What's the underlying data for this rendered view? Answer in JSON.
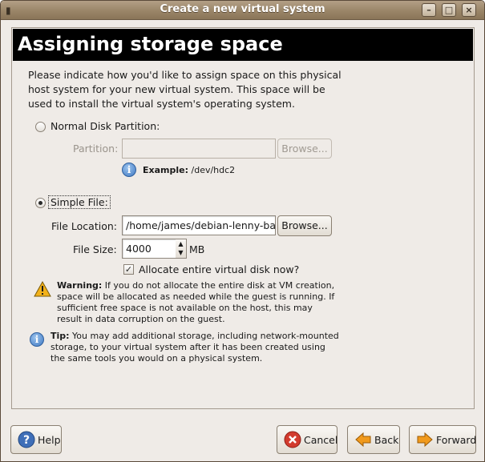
{
  "window": {
    "title": "Create a new virtual system"
  },
  "banner": {
    "title": "Assigning storage space"
  },
  "intro": {
    "text": "Please indicate how you'd like to assign space on this physical host system for your new virtual system. This space will be used to install the virtual system's operating system."
  },
  "normal_disk": {
    "radio_label": "Normal Disk Partition:",
    "partition_label": "Partition:",
    "partition_value": "",
    "browse_label": "Browse...",
    "example_label": "Example:",
    "example_value": "/dev/hdc2"
  },
  "simple_file": {
    "radio_label": "Simple File:",
    "location_label": "File Location:",
    "location_value": "/home/james/debian-lenny-base",
    "browse_label": "Browse...",
    "size_label": "File Size:",
    "size_value": "4000",
    "size_unit": "MB",
    "allocate_label": "Allocate entire virtual disk now?"
  },
  "warning": {
    "heading": "Warning:",
    "text": "If you do not allocate the entire disk at VM creation, space will be allocated as needed while the guest is running. If sufficient free space is not available on the host, this may result in data corruption on the guest."
  },
  "tip": {
    "heading": "Tip:",
    "text": "You may add additional storage, including network-mounted storage, to your virtual system after it has been created using the same tools you would on a physical system."
  },
  "buttons": {
    "help": "Help",
    "cancel": "Cancel",
    "back": "Back",
    "forward": "Forward"
  },
  "state": {
    "selected_storage": "simple_file",
    "allocate_checked": true
  },
  "colors": {
    "banner_bg": "#000000",
    "titlebar": "#9a8568",
    "window_bg": "#efebe7"
  }
}
